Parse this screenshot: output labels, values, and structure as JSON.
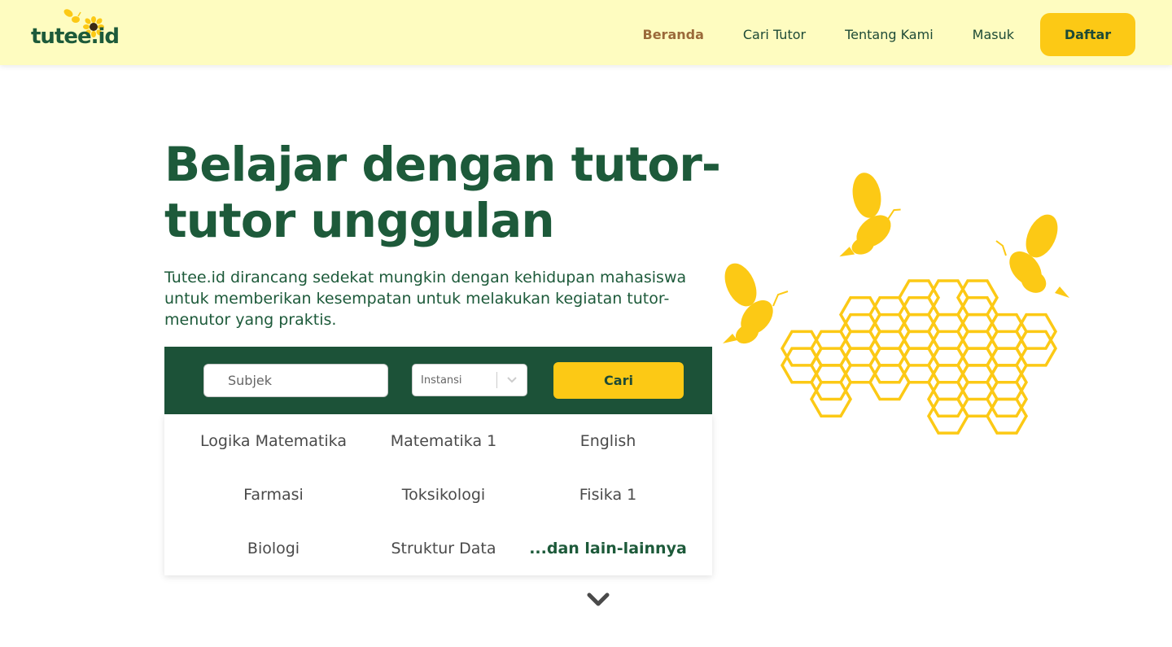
{
  "brand": {
    "logo_text": "tutee.id"
  },
  "nav": {
    "items": [
      {
        "label": "Beranda",
        "active": true
      },
      {
        "label": "Cari Tutor",
        "active": false
      },
      {
        "label": "Tentang Kami",
        "active": false
      },
      {
        "label": "Masuk",
        "active": false
      }
    ],
    "signup_label": "Daftar"
  },
  "hero": {
    "title": "Belajar dengan tutor-tutor unggulan",
    "description": "Tutee.id dirancang sedekat mungkin dengan kehidupan mahasiswa untuk memberikan kesempatan untuk melakukan kegiatan tutor-menutor yang praktis."
  },
  "search": {
    "subject_placeholder": "Subjek",
    "institution_placeholder": "Instansi",
    "search_label": "Cari"
  },
  "subjects": {
    "items": [
      "Logika Matematika",
      "Matematika 1",
      "English",
      "Farmasi",
      "Toksikologi",
      "Fisika 1",
      "Biologi",
      "Struktur Data"
    ],
    "more_label": "...dan lain-lainnya"
  },
  "colors": {
    "nav_bg": "#fefcc0",
    "primary_green": "#1d5a3a",
    "panel_green": "#1c5238",
    "accent_yellow": "#fcc915",
    "active_nav": "#9b6a3a"
  },
  "icons": [
    "bee-icon",
    "sunflower-icon",
    "chevron-down-icon",
    "honeycomb-illustration"
  ]
}
